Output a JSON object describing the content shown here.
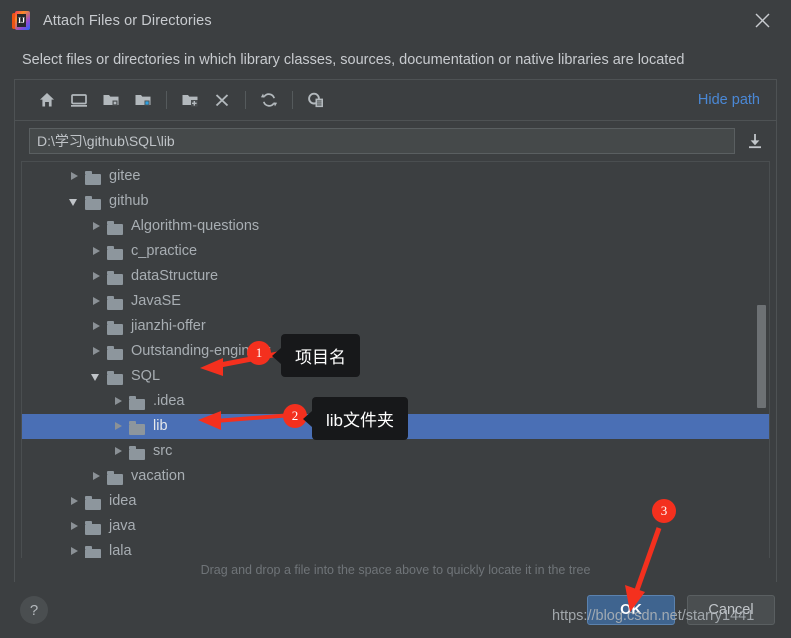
{
  "window": {
    "title": "Attach Files or Directories",
    "app_icon": "intellij-idea-icon",
    "close_icon": "close-icon",
    "subtitle": "Select files or directories in which library classes, sources, documentation or native libraries are located"
  },
  "toolbar": {
    "buttons": [
      {
        "name": "home-icon",
        "tooltip": "Home"
      },
      {
        "name": "desktop-icon",
        "tooltip": "Desktop"
      },
      {
        "name": "project-folder-icon",
        "tooltip": "Project"
      },
      {
        "name": "module-folder-icon",
        "tooltip": "Module"
      },
      {
        "name": "new-folder-icon",
        "tooltip": "New Folder"
      },
      {
        "name": "delete-icon",
        "tooltip": "Delete"
      },
      {
        "name": "refresh-icon",
        "tooltip": "Refresh"
      },
      {
        "name": "show-hidden-files-icon",
        "tooltip": "Show Hidden Files"
      }
    ],
    "hide_path_label": "Hide path"
  },
  "path": {
    "value": "D:\\学习\\github\\SQL\\lib",
    "placeholder": "",
    "expand_icon": "download-arrow-icon"
  },
  "tree": {
    "rows": [
      {
        "label": "gitee",
        "indent": 2,
        "state": "closed",
        "selected": false
      },
      {
        "label": "github",
        "indent": 2,
        "state": "open",
        "selected": false
      },
      {
        "label": "Algorithm-questions",
        "indent": 3,
        "state": "closed",
        "selected": false
      },
      {
        "label": "c_practice",
        "indent": 3,
        "state": "closed",
        "selected": false
      },
      {
        "label": "dataStructure",
        "indent": 3,
        "state": "closed",
        "selected": false
      },
      {
        "label": "JavaSE",
        "indent": 3,
        "state": "closed",
        "selected": false
      },
      {
        "label": "jianzhi-offer",
        "indent": 3,
        "state": "closed",
        "selected": false
      },
      {
        "label": "Outstanding-engineer",
        "indent": 3,
        "state": "closed",
        "selected": false
      },
      {
        "label": "SQL",
        "indent": 3,
        "state": "open",
        "selected": false
      },
      {
        "label": ".idea",
        "indent": 4,
        "state": "closed",
        "selected": false
      },
      {
        "label": "lib",
        "indent": 4,
        "state": "closed",
        "selected": true
      },
      {
        "label": "src",
        "indent": 4,
        "state": "closed",
        "selected": false
      },
      {
        "label": "vacation",
        "indent": 3,
        "state": "closed",
        "selected": false
      },
      {
        "label": "idea",
        "indent": 2,
        "state": "closed",
        "selected": false
      },
      {
        "label": "java",
        "indent": 2,
        "state": "closed",
        "selected": false
      },
      {
        "label": "lala",
        "indent": 2,
        "state": "closed",
        "selected": false
      }
    ],
    "scrollbar": {
      "name": "vertical-scrollbar"
    }
  },
  "hint": "Drag and drop a file into the space above to quickly locate it in the tree",
  "footer": {
    "help_label": "?",
    "ok_label": "OK",
    "cancel_label": "Cancel"
  },
  "annotations": {
    "badge1": "1",
    "badge2": "2",
    "badge3": "3",
    "callout1": "项目名",
    "callout2": "lib文件夹",
    "watermark": "https://blog.csdn.net/starry1441",
    "accent_color": "#f4301e"
  }
}
